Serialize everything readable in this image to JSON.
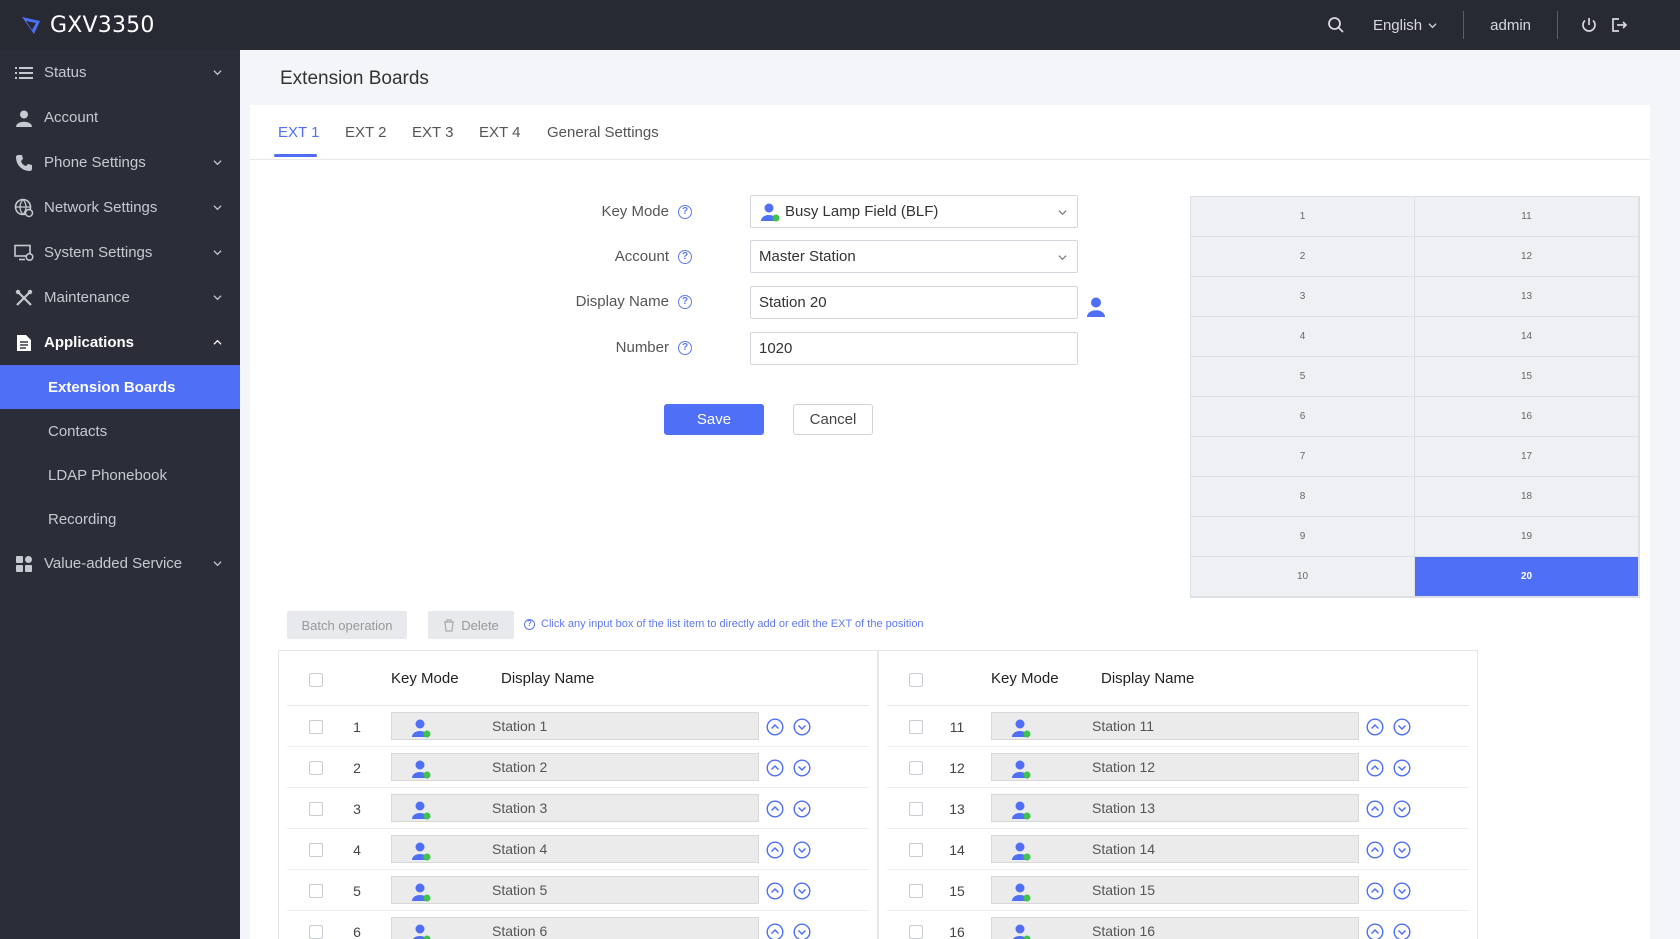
{
  "app": {
    "title": "GXV3350"
  },
  "header": {
    "language": "English",
    "user": "admin"
  },
  "sidebar": {
    "items": [
      {
        "label": "Status",
        "icon": "list-icon",
        "chevron": true
      },
      {
        "label": "Account",
        "icon": "user-icon",
        "chevron": false
      },
      {
        "label": "Phone Settings",
        "icon": "phone-icon",
        "chevron": true
      },
      {
        "label": "Network Settings",
        "icon": "globe-settings-icon",
        "chevron": true
      },
      {
        "label": "System Settings",
        "icon": "monitor-settings-icon",
        "chevron": true
      },
      {
        "label": "Maintenance",
        "icon": "tools-icon",
        "chevron": true
      },
      {
        "label": "Applications",
        "icon": "document-icon",
        "chevron": true
      }
    ],
    "sub_items": [
      {
        "label": "Extension Boards",
        "active": true
      },
      {
        "label": "Contacts",
        "active": false
      },
      {
        "label": "LDAP Phonebook",
        "active": false
      },
      {
        "label": "Recording",
        "active": false
      }
    ],
    "last_item": {
      "label": "Value-added Service",
      "icon": "apps-grid-icon"
    }
  },
  "page": {
    "title": "Extension Boards"
  },
  "tabs": [
    "EXT 1",
    "EXT 2",
    "EXT 3",
    "EXT 4",
    "General Settings"
  ],
  "form": {
    "key_mode": {
      "label": "Key Mode",
      "value": "Busy Lamp Field (BLF)"
    },
    "account": {
      "label": "Account",
      "value": "Master Station"
    },
    "display_name": {
      "label": "Display Name",
      "value": "Station 20"
    },
    "number": {
      "label": "Number",
      "value": "1020"
    },
    "save": "Save",
    "cancel": "Cancel"
  },
  "key_grid": {
    "left": [
      "1",
      "2",
      "3",
      "4",
      "5",
      "6",
      "7",
      "8",
      "9",
      "10"
    ],
    "right": [
      "11",
      "12",
      "13",
      "14",
      "15",
      "16",
      "17",
      "18",
      "19",
      "20"
    ],
    "selected": "20"
  },
  "batch": {
    "batch_label": "Batch operation",
    "delete_label": "Delete",
    "hint": "Click any input box of the list item to directly add or edit the EXT of the position"
  },
  "list_headers": {
    "key_mode": "Key Mode",
    "display_name": "Display Name"
  },
  "list_left": [
    {
      "num": "1",
      "name": "Station 1"
    },
    {
      "num": "2",
      "name": "Station 2"
    },
    {
      "num": "3",
      "name": "Station 3"
    },
    {
      "num": "4",
      "name": "Station 4"
    },
    {
      "num": "5",
      "name": "Station 5"
    },
    {
      "num": "6",
      "name": "Station 6"
    }
  ],
  "list_right": [
    {
      "num": "11",
      "name": "Station 11"
    },
    {
      "num": "12",
      "name": "Station 12"
    },
    {
      "num": "13",
      "name": "Station 13"
    },
    {
      "num": "14",
      "name": "Station 14"
    },
    {
      "num": "15",
      "name": "Station 15"
    },
    {
      "num": "16",
      "name": "Station 16"
    }
  ],
  "colors": {
    "accent": "#4e6ff6",
    "topbar": "#272a33",
    "sidebar": "#2b2e38",
    "presence_green": "#3ec24b"
  }
}
